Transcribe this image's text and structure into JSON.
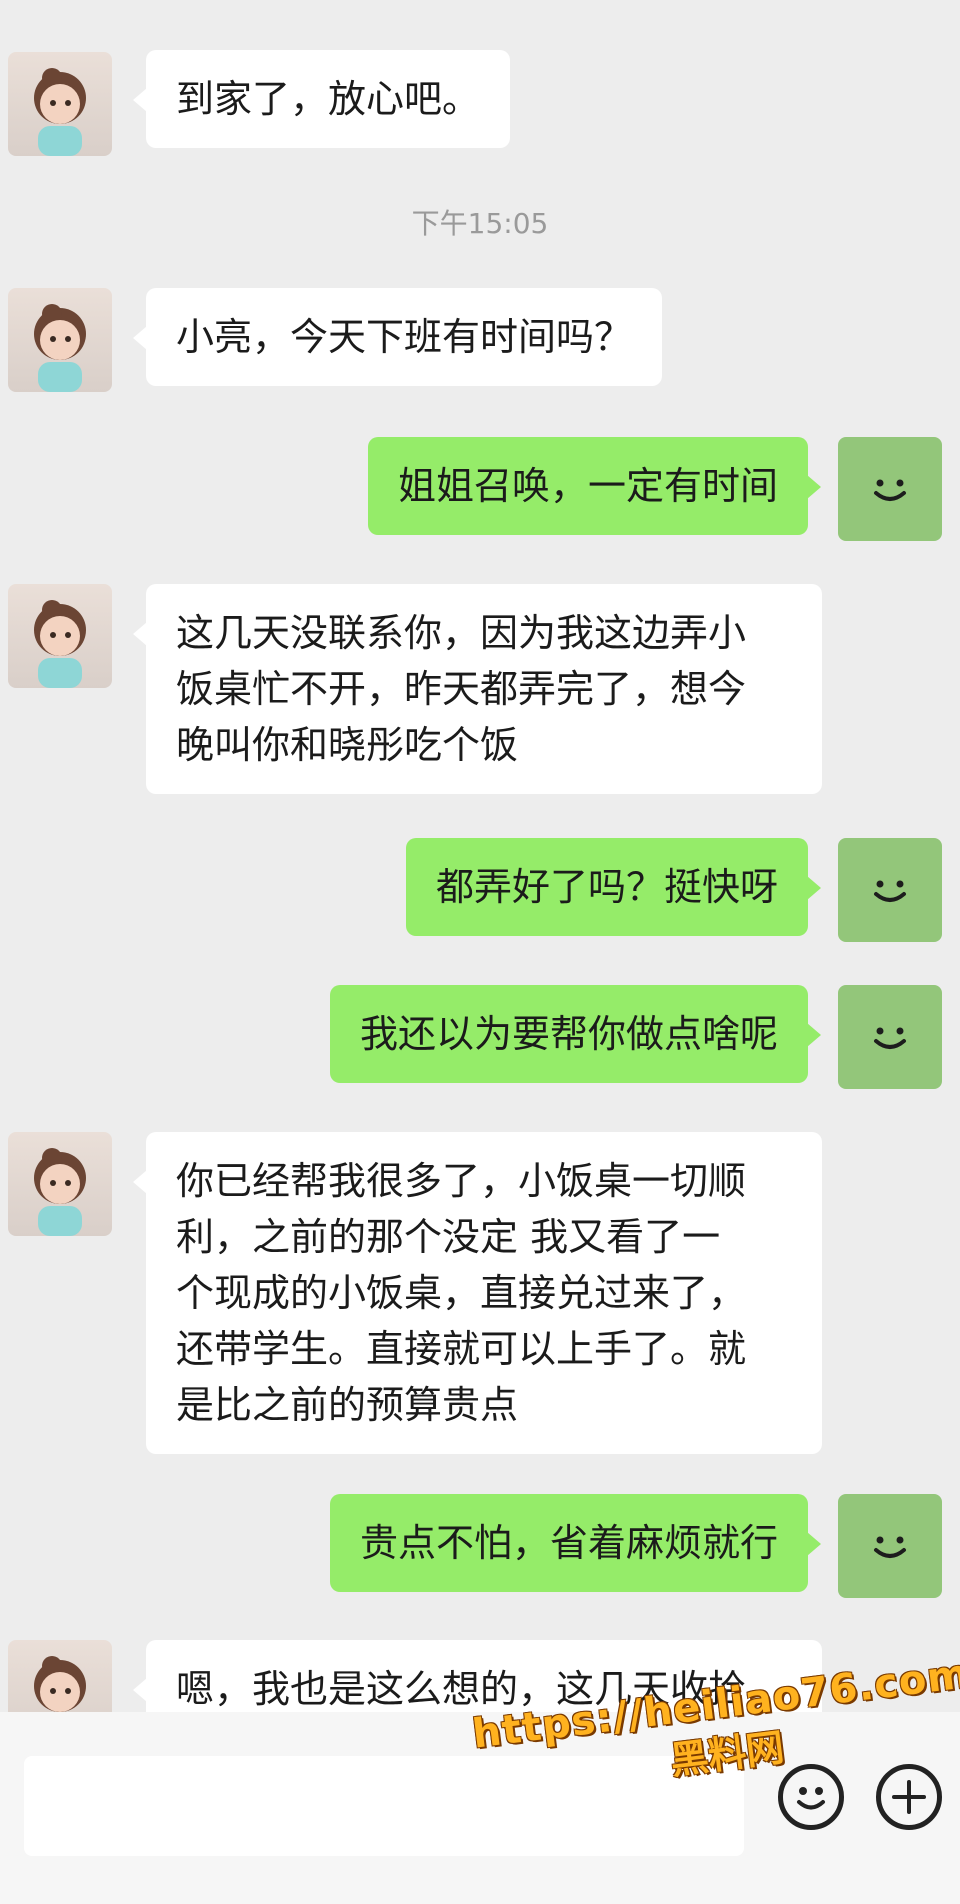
{
  "conversation": {
    "timestamp": "下午15:05",
    "messages": [
      {
        "from": "contact",
        "text": "到家了，放心吧。"
      },
      {
        "from": "contact",
        "text": "小亮，今天下班有时间吗？"
      },
      {
        "from": "me",
        "text": "姐姐召唤，一定有时间"
      },
      {
        "from": "contact",
        "text": "这几天没联系你，因为我这边弄小\n饭桌忙不开，昨天都弄完了，想今\n晚叫你和晓彤吃个饭"
      },
      {
        "from": "me",
        "text": "都弄好了吗？挺快呀"
      },
      {
        "from": "me",
        "text": "我还以为要帮你做点啥呢"
      },
      {
        "from": "contact",
        "text": "你已经帮我很多了，小饭桌一切顺\n利，之前的那个没定 我又看了一\n个现成的小饭桌，直接兑过来了，\n还带学生。直接就可以上手了。就\n是比之前的预算贵点"
      },
      {
        "from": "me",
        "text": "贵点不怕，省着麻烦就行"
      },
      {
        "from": "contact",
        "text": "嗯，我也是这么想的，这几天收拾"
      }
    ]
  },
  "watermark": {
    "url": "https://heiliao76.com",
    "name": "黑料网"
  },
  "colors": {
    "background": "#ededed",
    "incoming_bubble": "#ffffff",
    "outgoing_bubble": "#95ec69",
    "self_avatar": "#93c67a"
  },
  "icons": {
    "emoji_button": "emoji-face-icon",
    "more_button": "plus-circle-icon"
  }
}
